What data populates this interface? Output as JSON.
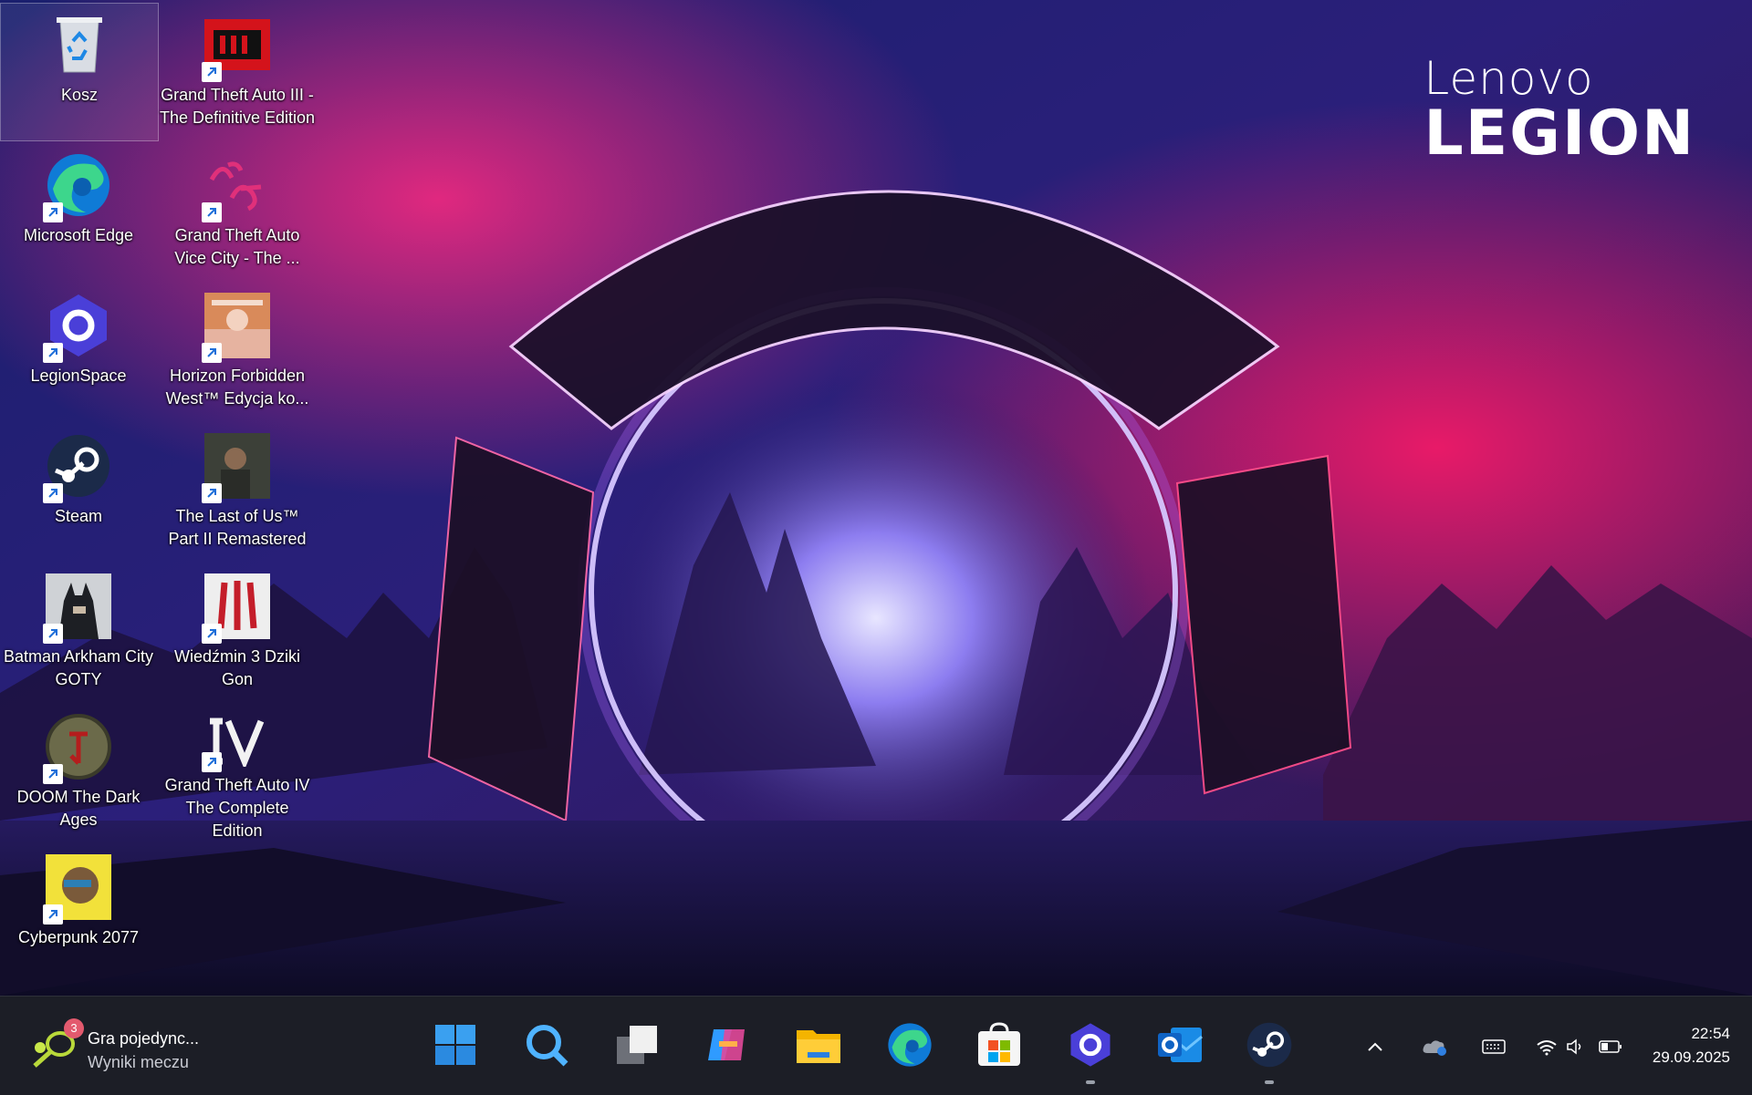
{
  "wallpaper": {
    "brand_line1": "Lenovo",
    "brand_line2": "LEGION",
    "colors": {
      "sky": "#1c1a5e",
      "magenta": "#d0207a",
      "ring": "#c8a8ff"
    }
  },
  "desktop": {
    "icons": [
      {
        "label": "Kosz",
        "icon": "recycle-bin-icon"
      },
      {
        "label": "Microsoft Edge",
        "icon": "edge-icon"
      },
      {
        "label": "LegionSpace",
        "icon": "legionspace-icon"
      },
      {
        "label": "Steam",
        "icon": "steam-icon"
      },
      {
        "label": "Batman Arkham City GOTY",
        "icon": "batman-icon"
      },
      {
        "label": "DOOM The Dark Ages",
        "icon": "doom-icon"
      },
      {
        "label": "Cyberpunk 2077",
        "icon": "cyberpunk-icon"
      },
      {
        "label": "Grand Theft Auto III - The Definitive Edition",
        "icon": "gta3-icon"
      },
      {
        "label": "Grand Theft Auto Vice City - The ...",
        "icon": "vice-city-icon"
      },
      {
        "label": "Horizon Forbidden West™ Edycja ko...",
        "icon": "horizon-icon"
      },
      {
        "label": "The Last of Us™ Part II Remastered",
        "icon": "last-of-us-icon"
      },
      {
        "label": "Wiedźmin 3 Dziki Gon",
        "icon": "witcher-icon"
      },
      {
        "label": "Grand Theft Auto IV The Complete Edition",
        "icon": "gta4-icon"
      }
    ]
  },
  "taskbar": {
    "widget": {
      "title": "Gra pojedync...",
      "subtitle": "Wyniki meczu",
      "badge": "3",
      "icon": "tennis-icon"
    },
    "apps": [
      {
        "name": "start",
        "icon": "windows-start-icon"
      },
      {
        "name": "search",
        "icon": "search-icon"
      },
      {
        "name": "task-view",
        "icon": "task-view-icon"
      },
      {
        "name": "copilot",
        "icon": "copilot-icon"
      },
      {
        "name": "file-explorer",
        "icon": "folder-icon"
      },
      {
        "name": "edge",
        "icon": "edge-icon"
      },
      {
        "name": "store",
        "icon": "store-icon"
      },
      {
        "name": "legionspace",
        "icon": "legionspace-icon"
      },
      {
        "name": "outlook",
        "icon": "outlook-icon"
      },
      {
        "name": "steam",
        "icon": "steam-icon"
      }
    ],
    "clock": {
      "time": "22:54",
      "date": "29.09.2025"
    }
  }
}
